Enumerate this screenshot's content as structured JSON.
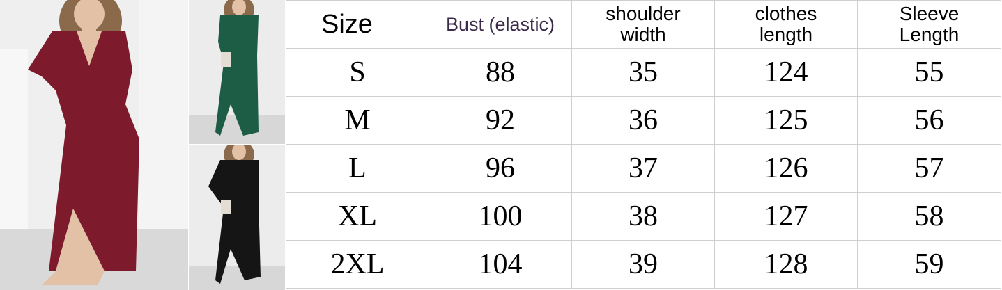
{
  "size_chart": {
    "headers": [
      "Size",
      "Bust (elastic)",
      "shoulder width",
      "clothes length",
      "Sleeve Length"
    ],
    "header_lines": {
      "shoulder": [
        "shoulder",
        "width"
      ],
      "length": [
        "clothes",
        "length"
      ],
      "sleeve": [
        "Sleeve",
        "Length"
      ]
    },
    "rows": [
      {
        "size": "S",
        "bust": "88",
        "shoulder": "35",
        "length": "124",
        "sleeve": "55"
      },
      {
        "size": "M",
        "bust": "92",
        "shoulder": "36",
        "length": "125",
        "sleeve": "56"
      },
      {
        "size": "L",
        "bust": "96",
        "shoulder": "37",
        "length": "126",
        "sleeve": "57"
      },
      {
        "size": "XL",
        "bust": "100",
        "shoulder": "38",
        "length": "127",
        "sleeve": "58"
      },
      {
        "size": "2XL",
        "bust": "104",
        "shoulder": "39",
        "length": "128",
        "sleeve": "59"
      }
    ]
  },
  "photos": {
    "main_color": "#7d1a2b",
    "green_color": "#1d5c45",
    "black_color": "#151515"
  }
}
